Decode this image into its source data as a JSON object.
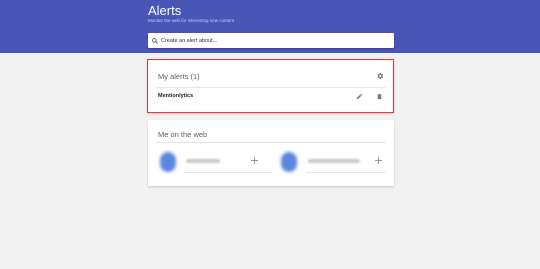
{
  "header": {
    "title": "Alerts",
    "subtitle": "Monitor the web for interesting new content",
    "background": "#4a55b8"
  },
  "search": {
    "placeholder": "Create an alert about...",
    "icon": "search-icon"
  },
  "my_alerts": {
    "title": "My alerts (1)",
    "settings_icon": "gear-icon",
    "items": [
      {
        "name": "Mentionlytics",
        "edit_icon": "pencil-icon",
        "delete_icon": "trash-icon"
      }
    ]
  },
  "me_on_web": {
    "title": "Me on the web",
    "add_icon": "plus-icon"
  },
  "highlight_color": "#e53935"
}
